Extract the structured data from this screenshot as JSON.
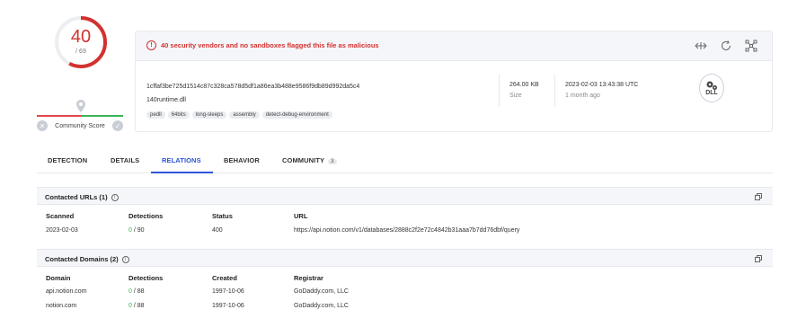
{
  "score": {
    "detections": "40",
    "total": "/ 69",
    "community_label": "Community Score",
    "minus": "✕",
    "plus": "✓"
  },
  "alert": {
    "icon": "!",
    "text": "40 security vendors and no sandboxes flagged this file as malicious"
  },
  "file": {
    "hash": "1cffaf3be725d1514c87c328ca578d5df1a86ea3b488e9586f9db89d992da5c4",
    "name": "140runtime.dll",
    "tags": [
      "pedll",
      "64bits",
      "long-sleeps",
      "assembly",
      "detect-debug-environment"
    ],
    "size_value": "264.00 KB",
    "size_label": "Size",
    "date_value": "2023-02-03 13:43:38 UTC",
    "date_label": "1 month ago",
    "type_label": "DLL"
  },
  "tabs": [
    {
      "label": "DETECTION"
    },
    {
      "label": "DETAILS"
    },
    {
      "label": "RELATIONS"
    },
    {
      "label": "BEHAVIOR"
    },
    {
      "label": "COMMUNITY",
      "badge": "3"
    }
  ],
  "contacted_urls": {
    "title": "Contacted URLs (1)",
    "info": "i",
    "headers": [
      "Scanned",
      "Detections",
      "Status",
      "URL"
    ],
    "rows": [
      {
        "scanned": "2023-02-03",
        "det_pos": "0",
        "det_total": " / 90",
        "status": "400",
        "url": "https://api.notion.com/v1/databases/2888c2f2e72c4842b31aaa7b7dd76dbf/query"
      }
    ]
  },
  "contacted_domains": {
    "title": "Contacted Domains (2)",
    "info": "i",
    "headers": [
      "Domain",
      "Detections",
      "Created",
      "Registrar"
    ],
    "rows": [
      {
        "domain": "api.notion.com",
        "det_pos": "0",
        "det_total": " / 88",
        "created": "1997-10-06",
        "registrar": "GoDaddy.com, LLC"
      },
      {
        "domain": "notion.com",
        "det_pos": "0",
        "det_total": " / 88",
        "created": "1997-10-06",
        "registrar": "GoDaddy.com, LLC"
      }
    ]
  },
  "colors": {
    "malicious": "#d3322f",
    "accent": "#2e55d6",
    "clean": "#3ab55a"
  }
}
